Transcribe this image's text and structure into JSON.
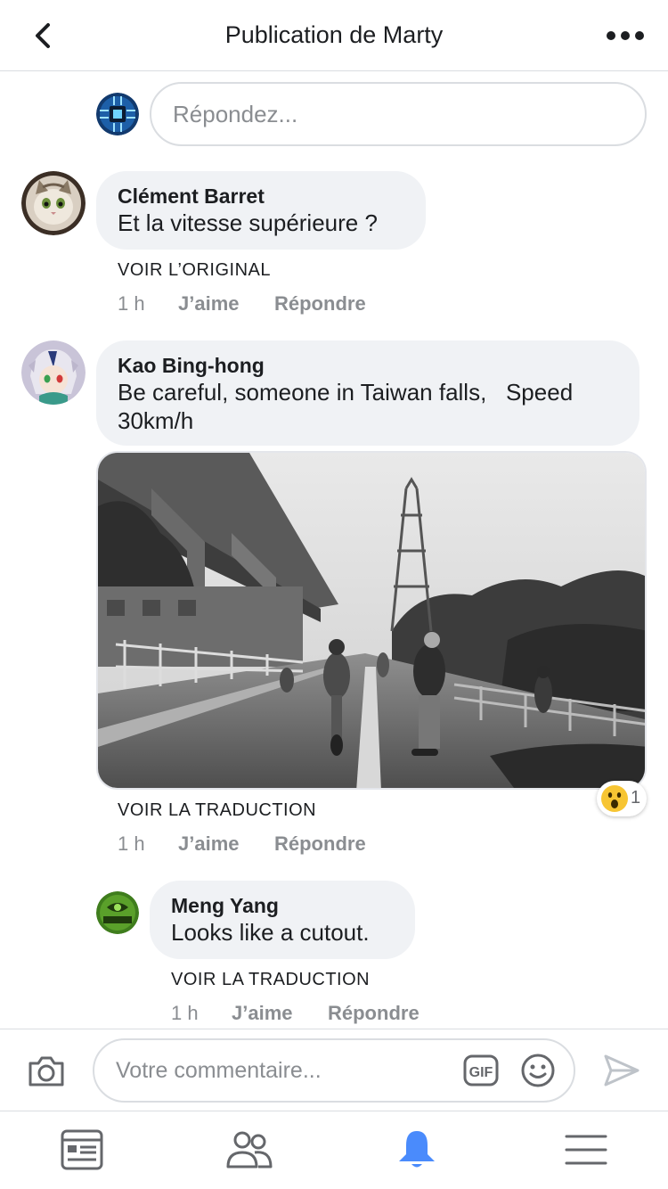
{
  "header": {
    "title": "Publication de Marty",
    "back_icon": "chevron-left-icon",
    "more_icon": "more-dots-icon"
  },
  "reply_input": {
    "placeholder": "Répondez..."
  },
  "comments": [
    {
      "author": "Clément Barret",
      "text": "Et la vitesse supérieure ?",
      "see_link": "VOIR L’ORIGINAL",
      "time": "1 h",
      "like": "J’aime",
      "reply": "Répondre"
    },
    {
      "author": "Kao Bing-hong",
      "text_line1": "Be careful, someone in Taiwan falls,   Speed",
      "text_line2": "30km/h",
      "see_link": "VOIR LA TRADUCTION",
      "time": "1 h",
      "like": "J’aime",
      "reply": "Répondre",
      "reaction": {
        "icon": "wow-emoji-icon",
        "count": "1"
      }
    },
    {
      "author": "Meng Yang",
      "text": "Looks like a cutout.",
      "see_link": "VOIR LA TRADUCTION",
      "time": "1 h",
      "like": "J’aime",
      "reply": "Répondre"
    }
  ],
  "composer": {
    "placeholder": "Votre commentaire...",
    "camera_icon": "camera-icon",
    "gif_icon": "gif-icon",
    "smiley_icon": "smiley-icon",
    "send_icon": "send-icon"
  },
  "tabbar": {
    "items": [
      "news-feed-icon",
      "friends-icon",
      "notifications-bell-icon",
      "menu-icon"
    ],
    "active": "notifications-bell-icon"
  },
  "colors": {
    "bubble": "#f0f2f5",
    "secondary_text": "#8a8d91",
    "active_tab": "#4a8bfc",
    "divider": "#dadde1"
  }
}
